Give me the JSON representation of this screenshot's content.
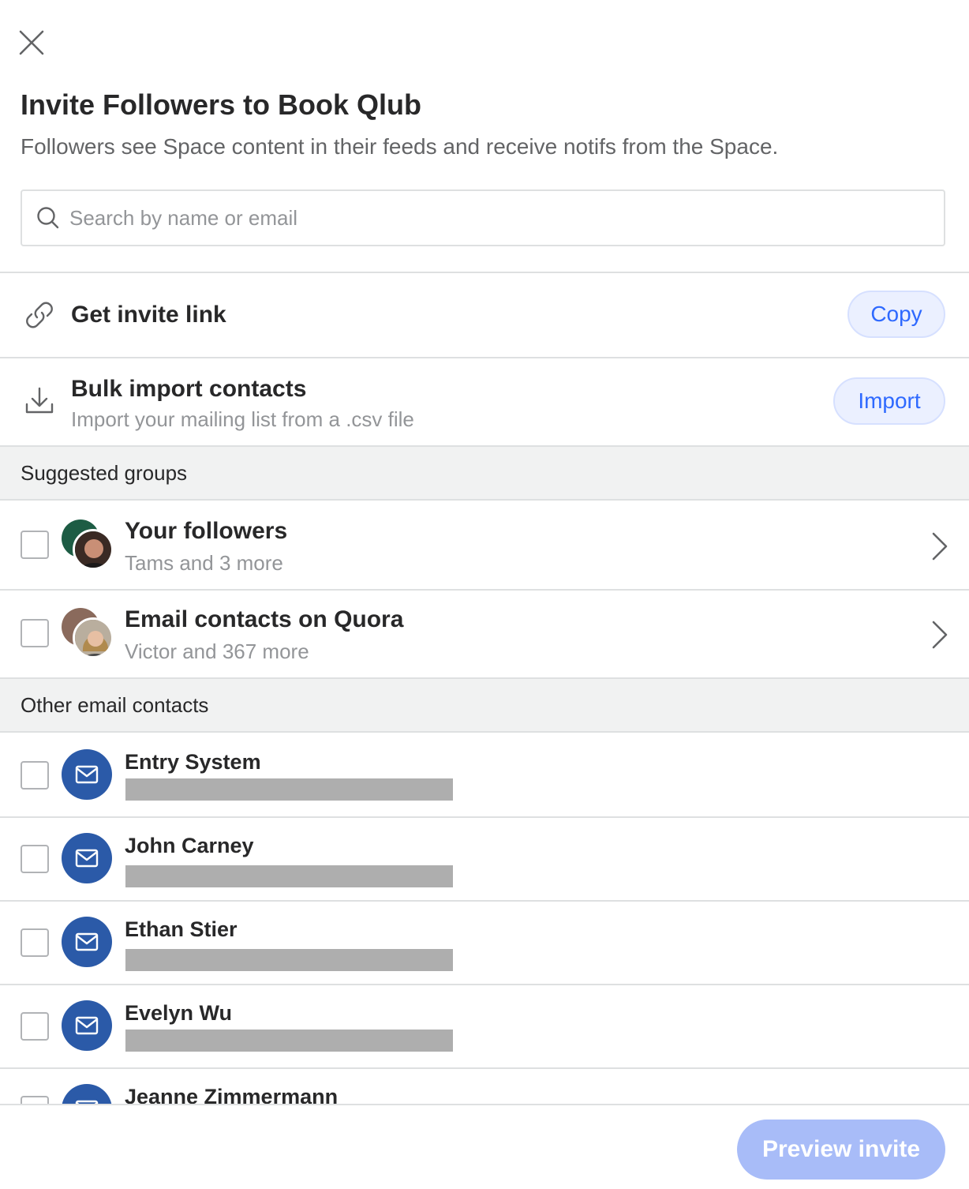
{
  "dialog": {
    "title": "Invite Followers to Book Qlub",
    "subtitle": "Followers see Space content in their feeds and receive notifs from the Space."
  },
  "search": {
    "placeholder": "Search by name or email",
    "value": ""
  },
  "invite_link": {
    "label": "Get invite link",
    "button": "Copy",
    "icon": "link-icon"
  },
  "bulk_import": {
    "label": "Bulk import contacts",
    "sublabel": "Import your mailing list from a .csv file",
    "button": "Import",
    "icon": "download-icon"
  },
  "suggested_groups": {
    "header": "Suggested groups",
    "items": [
      {
        "title": "Your followers",
        "subtitle": "Tams and 3 more",
        "checked": false
      },
      {
        "title": "Email contacts on Quora",
        "subtitle": "Victor and 367 more",
        "checked": false
      }
    ]
  },
  "other_contacts": {
    "header": "Other email contacts",
    "items": [
      {
        "name": "Entry System",
        "email_redacted": true,
        "checked": false
      },
      {
        "name": "John Carney",
        "email_redacted": true,
        "checked": false
      },
      {
        "name": "Ethan Stier",
        "email_redacted": true,
        "checked": false
      },
      {
        "name": "Evelyn Wu",
        "email_redacted": true,
        "checked": false
      },
      {
        "name": "Jeanne Zimmermann",
        "email_redacted": true,
        "checked": false
      }
    ]
  },
  "footer": {
    "primary_button": "Preview invite",
    "primary_enabled": false
  },
  "colors": {
    "accent": "#2e69ff",
    "pill_bg": "#ebf0ff",
    "mail_avatar": "#2b5aa8",
    "disabled_button": "#a8bcf8",
    "section_bg": "#f1f2f2"
  }
}
